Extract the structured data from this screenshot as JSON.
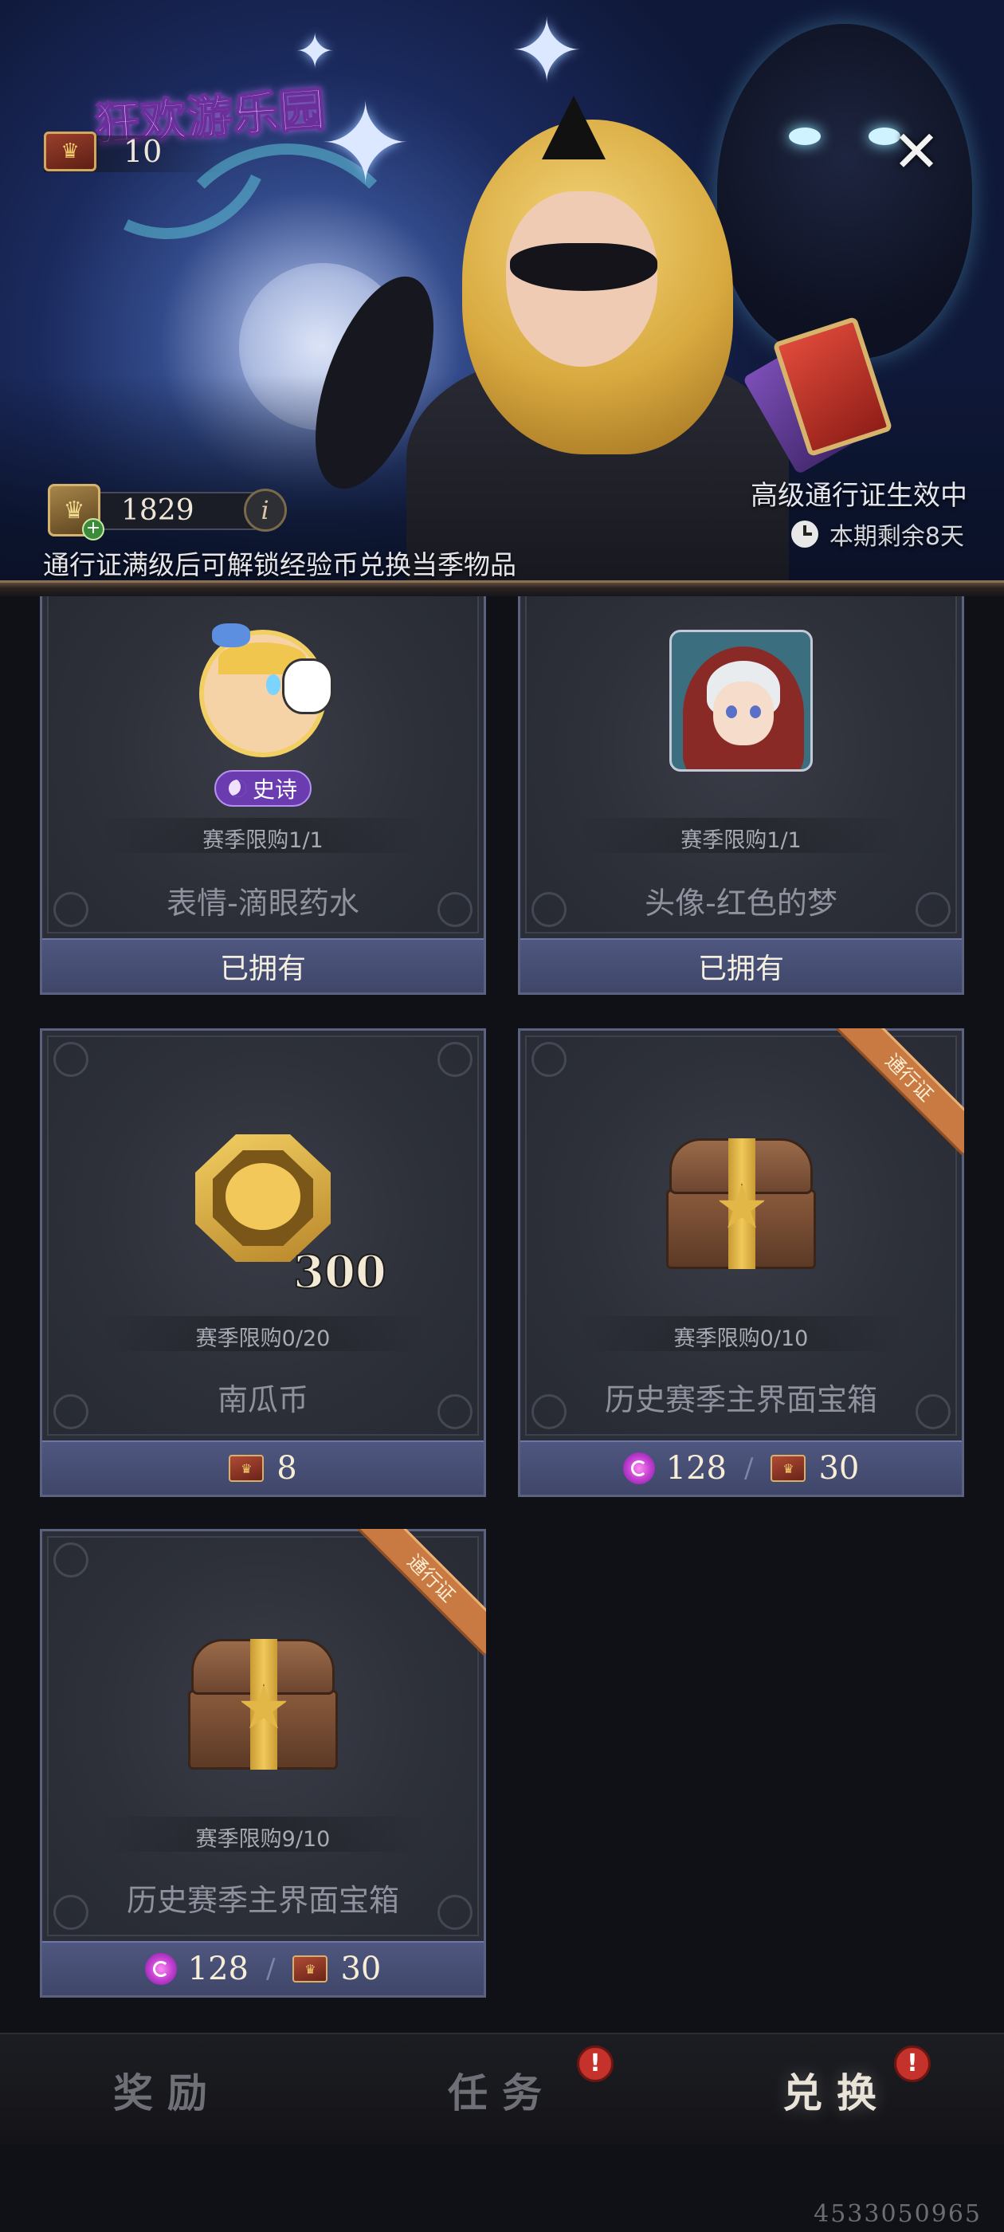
{
  "banner": {
    "event_title": "狂欢游乐园",
    "pass_level": "10",
    "exp_coins": "1829",
    "info_glyph": "i",
    "close_glyph": "✕",
    "pass_status": "高级通行证生效中",
    "time_remaining": "本期剩余8天",
    "note": "通行证满级后可解锁经验币兑换当季物品"
  },
  "items": [
    {
      "name": "表情-滴眼药水",
      "limit": "赛季限购1/1",
      "rarity": "史诗",
      "action": "已拥有"
    },
    {
      "name": "头像-红色的梦",
      "limit": "赛季限购1/1",
      "action": "已拥有"
    },
    {
      "name": "南瓜币",
      "limit": "赛季限购0/20",
      "quantity": "300",
      "cost_ticket": "8"
    },
    {
      "name": "历史赛季主界面宝箱",
      "limit": "赛季限购0/10",
      "ribbon": "通行证",
      "cost_candy": "128",
      "separator": "/",
      "cost_ticket": "30"
    },
    {
      "name": "历史赛季主界面宝箱",
      "limit": "赛季限购9/10",
      "ribbon": "通行证",
      "cost_candy": "128",
      "separator": "/",
      "cost_ticket": "30"
    }
  ],
  "nav": {
    "tabs": [
      {
        "label": "奖励",
        "active": false,
        "alert": false
      },
      {
        "label": "任务",
        "active": false,
        "alert": true
      },
      {
        "label": "兑换",
        "active": true,
        "alert": true
      }
    ],
    "alert_glyph": "!"
  },
  "footer_id": "4533050965",
  "colors": {
    "accent_footer": "#4f5780",
    "ribbon": "#c87a42",
    "epic_badge": "#6a3cb0",
    "alert": "#c4322b"
  }
}
